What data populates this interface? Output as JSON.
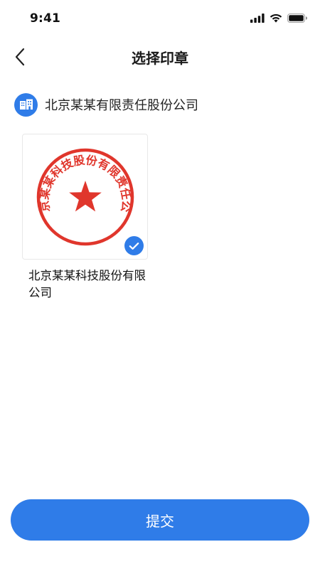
{
  "status_bar": {
    "time": "9:41"
  },
  "nav": {
    "title": "选择印章"
  },
  "company": {
    "name": "北京某某有限责任股份公司"
  },
  "seal": {
    "name": "北京某某科技股份有限公司",
    "ring_text": "北京某某科技股份有限责任公司",
    "selected": true,
    "color": "#e0362c"
  },
  "actions": {
    "submit_label": "提交"
  },
  "colors": {
    "accent": "#2f7ce8",
    "seal_red": "#e0362c"
  },
  "icons": {
    "back": "chevron-left-icon",
    "company": "building-icon",
    "selected": "check-icon"
  }
}
